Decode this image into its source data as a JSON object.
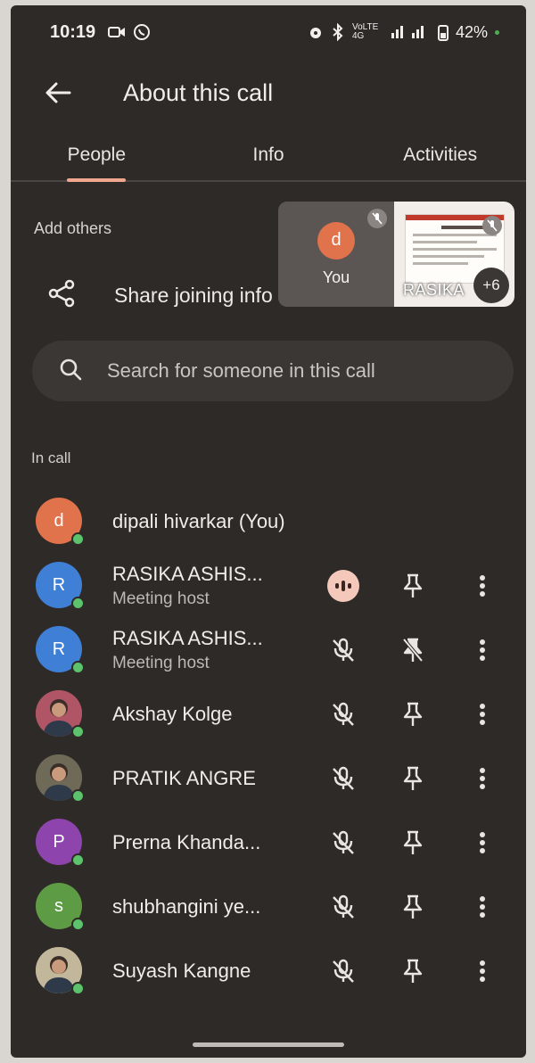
{
  "status_bar": {
    "time": "10:19",
    "network": "VoLTE 4G",
    "battery": "42%"
  },
  "header": {
    "title": "About this call"
  },
  "tabs": [
    {
      "label": "People",
      "active": true
    },
    {
      "label": "Info",
      "active": false
    },
    {
      "label": "Activities",
      "active": false
    }
  ],
  "add_others": {
    "heading": "Add others",
    "share_label": "Share joining info"
  },
  "tiles": {
    "you_initial": "d",
    "you_label": "You",
    "presenter_label": "RASIKA",
    "more_count": "+6"
  },
  "search": {
    "placeholder": "Search for someone in this call"
  },
  "in_call": {
    "heading": "In call"
  },
  "participants": [
    {
      "initial": "d",
      "color": "#e0724c",
      "name": "dipali hivarkar (You)",
      "role": "",
      "mic": "none",
      "pin": "none"
    },
    {
      "initial": "R",
      "color": "#3f7fd6",
      "name": "RASIKA ASHIS...",
      "role": "Meeting host",
      "mic": "speaking",
      "pin": "pin"
    },
    {
      "initial": "R",
      "color": "#3f7fd6",
      "name": "RASIKA ASHIS...",
      "role": "Meeting host",
      "mic": "muted",
      "pin": "pin-off"
    },
    {
      "initial": "",
      "color": "#b05566",
      "name": "Akshay Kolge",
      "role": "",
      "mic": "muted",
      "pin": "pin"
    },
    {
      "initial": "",
      "color": "#6f6a58",
      "name": "PRATIK ANGRE",
      "role": "",
      "mic": "muted",
      "pin": "pin"
    },
    {
      "initial": "P",
      "color": "#8e44ad",
      "name": "Prerna Khanda...",
      "role": "",
      "mic": "muted",
      "pin": "pin"
    },
    {
      "initial": "s",
      "color": "#5e9b45",
      "name": "shubhangini ye...",
      "role": "",
      "mic": "muted",
      "pin": "pin"
    },
    {
      "initial": "",
      "color": "#c2b79a",
      "name": "Suyash Kangne",
      "role": "",
      "mic": "muted",
      "pin": "pin"
    }
  ],
  "colors": {
    "background": "#2d2a28",
    "accent": "#f1a78d",
    "online": "#5cc26b"
  }
}
